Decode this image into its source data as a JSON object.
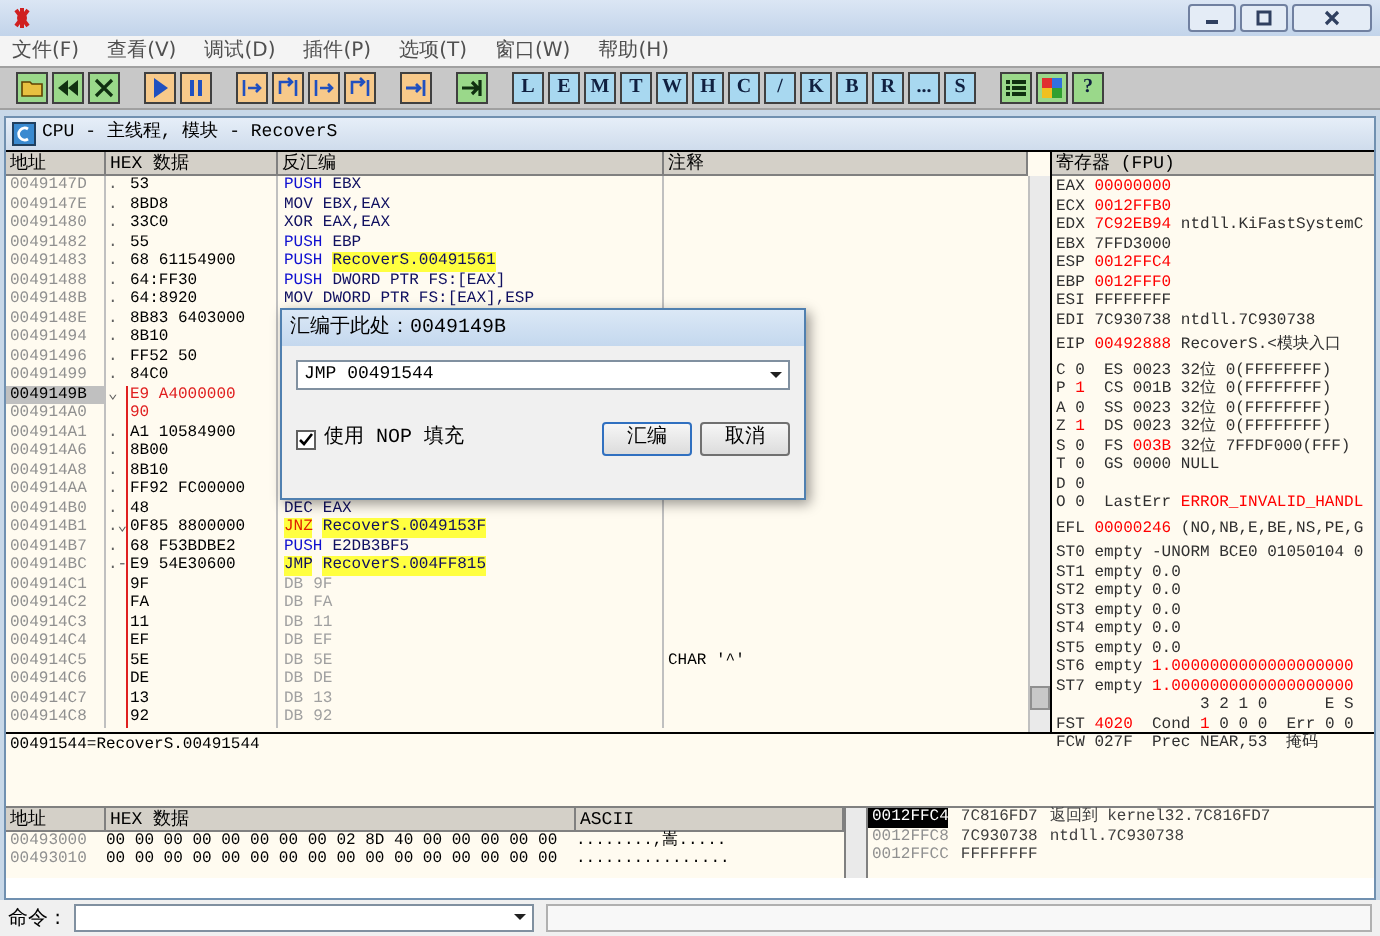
{
  "menu": [
    "文件(F)",
    "查看(V)",
    "调试(D)",
    "插件(P)",
    "选项(T)",
    "窗口(W)",
    "帮助(H)"
  ],
  "toolbar": [
    {
      "kind": "icon"
    },
    {
      "kind": "icon"
    },
    {
      "kind": "icon"
    },
    {
      "kind": "gap"
    },
    {
      "kind": "icon"
    },
    {
      "kind": "icon"
    },
    {
      "kind": "gap"
    },
    {
      "kind": "icon"
    },
    {
      "kind": "icon"
    },
    {
      "kind": "icon"
    },
    {
      "kind": "icon"
    },
    {
      "kind": "gap"
    },
    {
      "kind": "icon"
    },
    {
      "kind": "gap"
    },
    {
      "kind": "icon"
    },
    {
      "kind": "gap"
    },
    {
      "kind": "letter",
      "label": "L"
    },
    {
      "kind": "letter",
      "label": "E"
    },
    {
      "kind": "letter",
      "label": "M"
    },
    {
      "kind": "letter",
      "label": "T"
    },
    {
      "kind": "letter",
      "label": "W"
    },
    {
      "kind": "letter",
      "label": "H"
    },
    {
      "kind": "letter",
      "label": "C"
    },
    {
      "kind": "letter",
      "label": "/"
    },
    {
      "kind": "letter",
      "label": "K"
    },
    {
      "kind": "letter",
      "label": "B"
    },
    {
      "kind": "letter",
      "label": "R"
    },
    {
      "kind": "letter",
      "label": "..."
    },
    {
      "kind": "letter",
      "label": "S"
    },
    {
      "kind": "gap"
    },
    {
      "kind": "icon"
    },
    {
      "kind": "icon"
    },
    {
      "kind": "help",
      "label": "?"
    }
  ],
  "cpu_window": {
    "title": "CPU - 主线程, 模块 - RecoverS"
  },
  "disasm": {
    "columns": [
      "地址",
      "HEX 数据",
      "反汇编",
      "注释"
    ],
    "rows": [
      {
        "addr": "0049147D",
        "mark": ".",
        "hex": "53",
        "op": "PUSH",
        "arg": "EBX",
        "kind": "push",
        "selected": false,
        "modified": false,
        "line": false
      },
      {
        "addr": "0049147E",
        "mark": ".",
        "hex": "8BD8",
        "op": "MOV",
        "arg": "EBX,EAX",
        "kind": "plain",
        "selected": false,
        "modified": false,
        "line": false
      },
      {
        "addr": "00491480",
        "mark": ".",
        "hex": "33C0",
        "op": "XOR",
        "arg": "EAX,EAX",
        "kind": "plain",
        "selected": false,
        "modified": false,
        "line": false
      },
      {
        "addr": "00491482",
        "mark": ".",
        "hex": "55",
        "op": "PUSH",
        "arg": "EBP",
        "kind": "push",
        "selected": false,
        "modified": false,
        "line": false
      },
      {
        "addr": "00491483",
        "mark": ".",
        "hex": "68 61154900",
        "op": "PUSH",
        "arg": "RecoverS.00491561",
        "kind": "pushref",
        "selected": false,
        "modified": false,
        "line": false
      },
      {
        "addr": "00491488",
        "mark": ".",
        "hex": "64:FF30",
        "op": "PUSH",
        "arg": "DWORD PTR FS:[EAX]",
        "kind": "push",
        "selected": false,
        "modified": false,
        "line": false
      },
      {
        "addr": "0049148B",
        "mark": ".",
        "hex": "64:8920",
        "op": "MOV",
        "arg": "DWORD PTR FS:[EAX],ESP",
        "kind": "plain",
        "selected": false,
        "modified": false,
        "line": false
      },
      {
        "addr": "0049148E",
        "mark": ".",
        "hex": "8B83 6403000",
        "kind": "hidden",
        "selected": false,
        "modified": false,
        "line": false
      },
      {
        "addr": "00491494",
        "mark": ".",
        "hex": "8B10",
        "kind": "hidden",
        "selected": false,
        "modified": false,
        "line": false
      },
      {
        "addr": "00491496",
        "mark": ".",
        "hex": "FF52 50",
        "kind": "hidden",
        "selected": false,
        "modified": false,
        "line": false
      },
      {
        "addr": "00491499",
        "mark": ".",
        "hex": "84C0",
        "kind": "hidden",
        "selected": false,
        "modified": false,
        "line": false
      },
      {
        "addr": "0049149B",
        "mark": "⌄",
        "hex": "E9 A4000000",
        "kind": "hidden",
        "selected": true,
        "modified": true,
        "line": true
      },
      {
        "addr": "004914A0",
        "mark": "",
        "hex": "90",
        "kind": "hidden",
        "selected": false,
        "modified": true,
        "line": true
      },
      {
        "addr": "004914A1",
        "mark": ".",
        "hex": "A1 10584900",
        "kind": "hidden",
        "selected": false,
        "modified": false,
        "line": true
      },
      {
        "addr": "004914A6",
        "mark": ".",
        "hex": "8B00",
        "kind": "hidden",
        "selected": false,
        "modified": false,
        "line": true
      },
      {
        "addr": "004914A8",
        "mark": ".",
        "hex": "8B10",
        "kind": "hidden",
        "selected": false,
        "modified": false,
        "line": true
      },
      {
        "addr": "004914AA",
        "mark": ".",
        "hex": "FF92 FC00000",
        "kind": "hidden",
        "selected": false,
        "modified": false,
        "line": true
      },
      {
        "addr": "004914B0",
        "mark": ".",
        "hex": "48",
        "op": "DEC",
        "arg": "EAX",
        "kind": "plain",
        "selected": false,
        "modified": false,
        "line": true
      },
      {
        "addr": "004914B1",
        "mark": ".⌄",
        "hex": "0F85 8800000",
        "op": "JNZ",
        "arg": "RecoverS.0049153F",
        "kind": "jcc",
        "selected": false,
        "modified": false,
        "line": true
      },
      {
        "addr": "004914B7",
        "mark": ".",
        "hex": "68 F53BDBE2",
        "op": "PUSH",
        "arg": "E2DB3BF5",
        "kind": "push",
        "selected": false,
        "modified": false,
        "line": true
      },
      {
        "addr": "004914BC",
        "mark": ".-",
        "hex": "E9 54E30600",
        "op": "JMP",
        "arg": "RecoverS.004FF815",
        "kind": "jmp",
        "selected": false,
        "modified": false,
        "line": true
      },
      {
        "addr": "004914C1",
        "mark": "",
        "hex": "9F",
        "op": "DB",
        "arg": "9F",
        "kind": "db",
        "selected": false,
        "modified": false,
        "line": true
      },
      {
        "addr": "004914C2",
        "mark": "",
        "hex": "FA",
        "op": "DB",
        "arg": "FA",
        "kind": "db",
        "selected": false,
        "modified": false,
        "line": true
      },
      {
        "addr": "004914C3",
        "mark": "",
        "hex": "11",
        "op": "DB",
        "arg": "11",
        "kind": "db",
        "selected": false,
        "modified": false,
        "line": true
      },
      {
        "addr": "004914C4",
        "mark": "",
        "hex": "EF",
        "op": "DB",
        "arg": "EF",
        "kind": "db",
        "selected": false,
        "modified": false,
        "line": true
      },
      {
        "addr": "004914C5",
        "mark": "",
        "hex": "5E",
        "op": "DB",
        "arg": "5E",
        "kind": "db",
        "comment": "CHAR '^'",
        "selected": false,
        "modified": false,
        "line": true
      },
      {
        "addr": "004914C6",
        "mark": "",
        "hex": "DE",
        "op": "DB",
        "arg": "DE",
        "kind": "db",
        "selected": false,
        "modified": false,
        "line": true
      },
      {
        "addr": "004914C7",
        "mark": "",
        "hex": "13",
        "op": "DB",
        "arg": "13",
        "kind": "db",
        "selected": false,
        "modified": false,
        "line": true
      },
      {
        "addr": "004914C8",
        "mark": "",
        "hex": "92",
        "op": "DB",
        "arg": "92",
        "kind": "db",
        "selected": false,
        "modified": false,
        "line": true
      }
    ]
  },
  "dialog": {
    "title": "汇编于此处：0049149B",
    "command": "JMP 00491544",
    "nop_fill": {
      "label": "使用 NOP 填充",
      "checked": true
    },
    "buttons": [
      "汇编",
      "取消"
    ]
  },
  "registers": {
    "title": "寄存器 (FPU)",
    "groups": [
      [
        {
          "parts": [
            {
              "text": "EAX ",
              "changed": false
            },
            {
              "text": "00000000",
              "changed": true
            }
          ]
        },
        {
          "parts": [
            {
              "text": "ECX ",
              "changed": false
            },
            {
              "text": "0012FFB0",
              "changed": true
            }
          ]
        },
        {
          "parts": [
            {
              "text": "EDX ",
              "changed": false
            },
            {
              "text": "7C92EB94",
              "changed": true
            },
            {
              "text": " ntdll.KiFastSystemC",
              "changed": false
            }
          ]
        },
        {
          "parts": [
            {
              "text": "EBX 7FFD3000",
              "changed": false
            }
          ]
        },
        {
          "parts": [
            {
              "text": "ESP ",
              "changed": false
            },
            {
              "text": "0012FFC4",
              "changed": true
            }
          ]
        },
        {
          "parts": [
            {
              "text": "EBP ",
              "changed": false
            },
            {
              "text": "0012FFF0",
              "changed": true
            }
          ]
        },
        {
          "parts": [
            {
              "text": "ESI FFFFFFFF",
              "changed": false
            }
          ]
        },
        {
          "parts": [
            {
              "text": "EDI 7C930738 ntdll.7C930738",
              "changed": false
            }
          ]
        }
      ],
      [
        {
          "parts": [
            {
              "text": "EIP ",
              "changed": false
            },
            {
              "text": "00492888",
              "changed": true
            },
            {
              "text": " RecoverS.<模块入口",
              "changed": false
            }
          ]
        }
      ],
      [
        {
          "parts": [
            {
              "text": "C 0  ES 0023 32位 0(FFFFFFFF)",
              "changed": false
            }
          ]
        },
        {
          "parts": [
            {
              "text": "P ",
              "changed": false
            },
            {
              "text": "1",
              "changed": true
            },
            {
              "text": "  CS 001B 32位 0(FFFFFFFF)",
              "changed": false
            }
          ]
        },
        {
          "parts": [
            {
              "text": "A 0  SS 0023 32位 0(FFFFFFFF)",
              "changed": false
            }
          ]
        },
        {
          "parts": [
            {
              "text": "Z ",
              "changed": false
            },
            {
              "text": "1",
              "changed": true
            },
            {
              "text": "  DS 0023 32位 0(FFFFFFFF)",
              "changed": false
            }
          ]
        },
        {
          "parts": [
            {
              "text": "S 0  FS ",
              "changed": false
            },
            {
              "text": "003B",
              "changed": true
            },
            {
              "text": " 32位 7FFDF000(FFF)",
              "changed": false
            }
          ]
        },
        {
          "parts": [
            {
              "text": "T 0  GS 0000 NULL",
              "changed": false
            }
          ]
        },
        {
          "parts": [
            {
              "text": "D 0",
              "changed": false
            }
          ]
        },
        {
          "parts": [
            {
              "text": "O 0  LastErr ",
              "changed": false
            },
            {
              "text": "ERROR_INVALID_HANDL",
              "changed": true
            }
          ]
        }
      ],
      [
        {
          "parts": [
            {
              "text": "EFL ",
              "changed": false
            },
            {
              "text": "00000246",
              "changed": true
            },
            {
              "text": " (NO,NB,E,BE,NS,PE,G",
              "changed": false
            }
          ]
        }
      ],
      [
        {
          "parts": [
            {
              "text": "ST0 empty -UNORM BCE0 01050104 0",
              "changed": false
            }
          ]
        },
        {
          "parts": [
            {
              "text": "ST1 empty 0.0",
              "changed": false
            }
          ]
        },
        {
          "parts": [
            {
              "text": "ST2 empty 0.0",
              "changed": false
            }
          ]
        },
        {
          "parts": [
            {
              "text": "ST3 empty 0.0",
              "changed": false
            }
          ]
        },
        {
          "parts": [
            {
              "text": "ST4 empty 0.0",
              "changed": false
            }
          ]
        },
        {
          "parts": [
            {
              "text": "ST5 empty 0.0",
              "changed": false
            }
          ]
        },
        {
          "parts": [
            {
              "text": "ST6 empty ",
              "changed": false
            },
            {
              "text": "1.0000000000000000000",
              "changed": true
            }
          ]
        },
        {
          "parts": [
            {
              "text": "ST7 empty ",
              "changed": false
            },
            {
              "text": "1.0000000000000000000",
              "changed": true
            }
          ]
        },
        {
          "parts": [
            {
              "text": "               3 2 1 0      E S",
              "changed": false
            }
          ]
        },
        {
          "parts": [
            {
              "text": "FST ",
              "changed": false
            },
            {
              "text": "4020",
              "changed": true
            },
            {
              "text": "  Cond ",
              "changed": false
            },
            {
              "text": "1",
              "changed": true
            },
            {
              "text": " 0 0 0  Err 0 0",
              "changed": false
            }
          ]
        },
        {
          "parts": [
            {
              "text": "FCW 027F  Prec NEAR,53  掩码",
              "changed": false
            }
          ]
        }
      ]
    ]
  },
  "info": "00491544=RecoverS.00491544",
  "dump": {
    "columns": [
      "地址",
      "HEX 数据",
      "ASCII"
    ],
    "rows": [
      {
        "addr": "00493000",
        "hex": "00 00 00 00 00 00 00 00 02 8D 40 00 00 00 00 00",
        "ascii": "........,嵩....."
      },
      {
        "addr": "00493010",
        "hex": "00 00 00 00 00 00 00 00 00 00 00 00 00 00 00 00",
        "ascii": "................"
      }
    ]
  },
  "stack": [
    {
      "addr": "0012FFC4",
      "value": "7C816FD7",
      "comment": "返回到 kernel32.7C816FD7",
      "selected": true
    },
    {
      "addr": "0012FFC8",
      "value": "7C930738",
      "comment": "ntdll.7C930738",
      "selected": false
    },
    {
      "addr": "0012FFCC",
      "value": "FFFFFFFF",
      "selected": false
    }
  ],
  "command": {
    "label": "命令 :"
  }
}
